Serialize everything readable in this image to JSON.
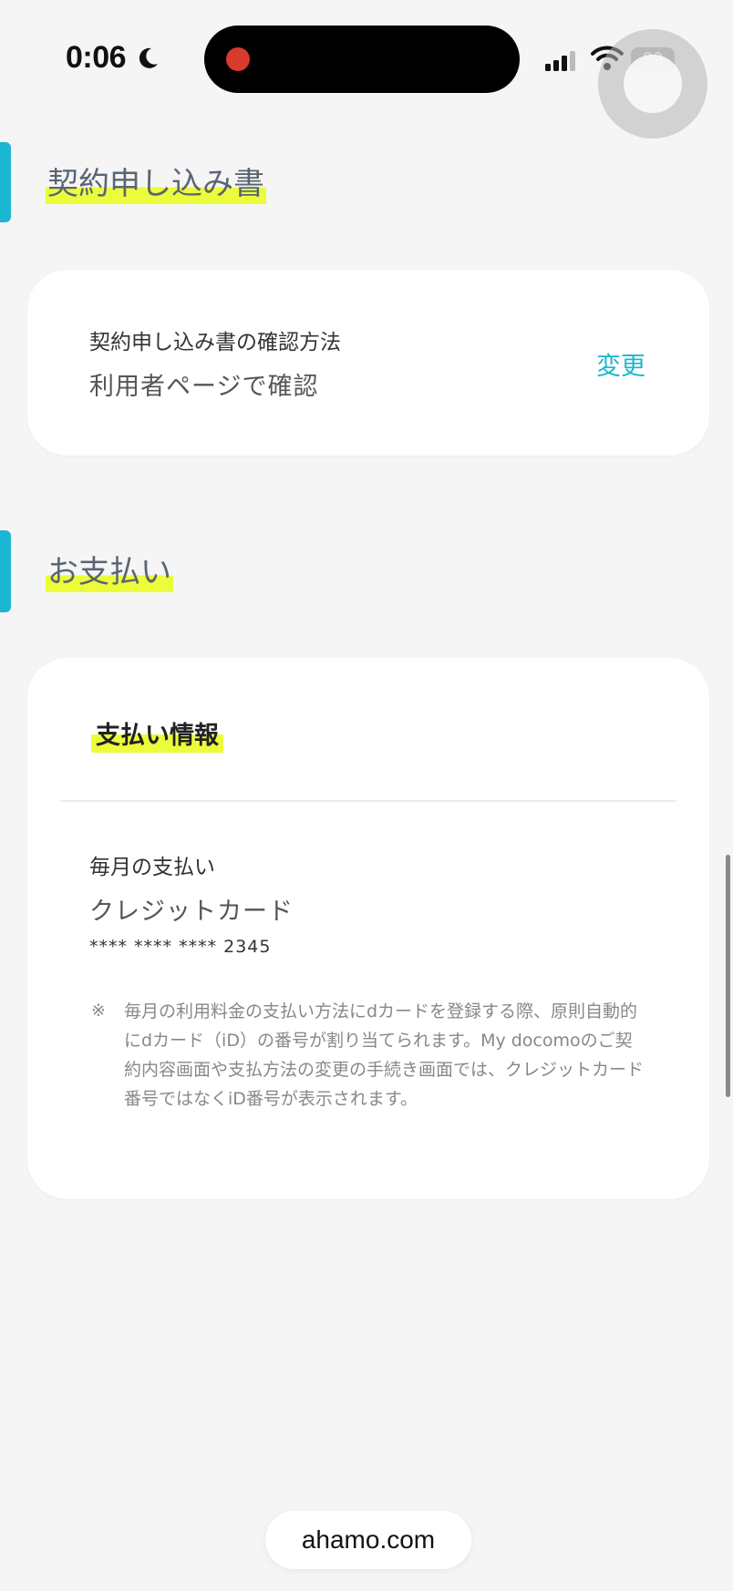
{
  "status_bar": {
    "time": "0:06",
    "battery": "80"
  },
  "sections": {
    "contract": {
      "title": "契約申し込み書",
      "card": {
        "label": "契約申し込み書の確認方法",
        "value": "利用者ページで確認",
        "change_link": "変更"
      }
    },
    "payment": {
      "title": "お支払い",
      "card": {
        "subtitle": "支払い情報",
        "label": "毎月の支払い",
        "value": "クレジットカード",
        "card_number": "**** **** ****  2345",
        "note_mark": "※",
        "note": "毎月の利用料金の支払い方法にdカードを登録する際、原則自動的にdカード（iD）の番号が割り当てられます。My docomoのご契約内容画面や支払方法の変更の手続き画面では、クレジットカード番号ではなくiD番号が表示されます。"
      }
    }
  },
  "browser": {
    "url": "ahamo.com"
  },
  "colors": {
    "accent": "#1bb6d1",
    "highlight": "#ecfc3a",
    "background": "#f5f5f5"
  }
}
